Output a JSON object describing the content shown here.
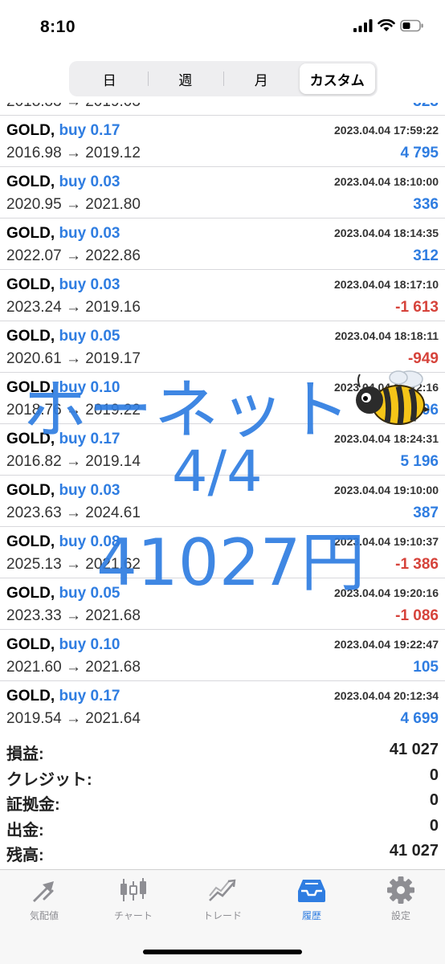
{
  "status_bar": {
    "time": "8:10"
  },
  "segments": [
    {
      "label": "日",
      "active": false
    },
    {
      "label": "週",
      "active": false
    },
    {
      "label": "月",
      "active": false
    },
    {
      "label": "カスタム",
      "active": true
    }
  ],
  "deals": [
    {
      "symbol": "GOLD,",
      "side": "buy 0.17",
      "time": "2023.04.04 17:59:22",
      "open": "2016.98",
      "close": "2019.12",
      "profit": "4 795",
      "negative": false
    },
    {
      "symbol": "GOLD,",
      "side": "buy 0.03",
      "time": "2023.04.04 18:10:00",
      "open": "2020.95",
      "close": "2021.80",
      "profit": "336",
      "negative": false
    },
    {
      "symbol": "GOLD,",
      "side": "buy 0.03",
      "time": "2023.04.04 18:14:35",
      "open": "2022.07",
      "close": "2022.86",
      "profit": "312",
      "negative": false
    },
    {
      "symbol": "GOLD,",
      "side": "buy 0.03",
      "time": "2023.04.04 18:17:10",
      "open": "2023.24",
      "close": "2019.16",
      "profit": "-1 613",
      "negative": true
    },
    {
      "symbol": "GOLD,",
      "side": "buy 0.05",
      "time": "2023.04.04 18:18:11",
      "open": "2020.61",
      "close": "2019.17",
      "profit": "-949",
      "negative": true
    },
    {
      "symbol": "GOLD,",
      "side": "buy 0.10",
      "time": "2023.04.04 18:22:16",
      "open": "2018.76",
      "close": "2019.22",
      "profit": "406",
      "negative": false
    },
    {
      "symbol": "GOLD,",
      "side": "buy 0.17",
      "time": "2023.04.04 18:24:31",
      "open": "2016.82",
      "close": "2019.14",
      "profit": "5 196",
      "negative": false
    },
    {
      "symbol": "GOLD,",
      "side": "buy 0.03",
      "time": "2023.04.04 19:10:00",
      "open": "2023.63",
      "close": "2024.61",
      "profit": "387",
      "negative": false
    },
    {
      "symbol": "GOLD,",
      "side": "buy 0.08",
      "time": "2023.04.04 19:10:37",
      "open": "2025.13",
      "close": "2021.62",
      "profit": "-1 386",
      "negative": true
    },
    {
      "symbol": "GOLD,",
      "side": "buy 0.05",
      "time": "2023.04.04 19:20:16",
      "open": "2023.33",
      "close": "2021.68",
      "profit": "-1 086",
      "negative": true
    },
    {
      "symbol": "GOLD,",
      "side": "buy 0.10",
      "time": "2023.04.04 19:22:47",
      "open": "2021.60",
      "close": "2021.68",
      "profit": "105",
      "negative": false
    },
    {
      "symbol": "GOLD,",
      "side": "buy 0.17",
      "time": "2023.04.04 20:12:34",
      "open": "2019.54",
      "close": "2021.64",
      "profit": "4 699",
      "negative": false
    }
  ],
  "arrow": "→",
  "summary": [
    {
      "label": "損益:",
      "value": "41 027"
    },
    {
      "label": "クレジット:",
      "value": "0"
    },
    {
      "label": "証拠金:",
      "value": "0"
    },
    {
      "label": "出金:",
      "value": "0"
    },
    {
      "label": "残高:",
      "value": "41 027"
    }
  ],
  "tabbar": [
    {
      "label": "気配値",
      "icon": "arrows-icon",
      "active": false
    },
    {
      "label": "チャート",
      "icon": "candlestick-icon",
      "active": false
    },
    {
      "label": "トレード",
      "icon": "trend-icon",
      "active": false
    },
    {
      "label": "履歴",
      "icon": "inbox-icon",
      "active": true
    },
    {
      "label": "設定",
      "icon": "gear-icon",
      "active": false
    }
  ],
  "overlay": {
    "line1": "ホーネット",
    "line2": "4/4",
    "line3": "41027円",
    "emoji": "bee-icon"
  },
  "colors": {
    "accent": "#2f7de1",
    "negative": "#d6433b",
    "inactive_tab": "#8e8e93"
  }
}
